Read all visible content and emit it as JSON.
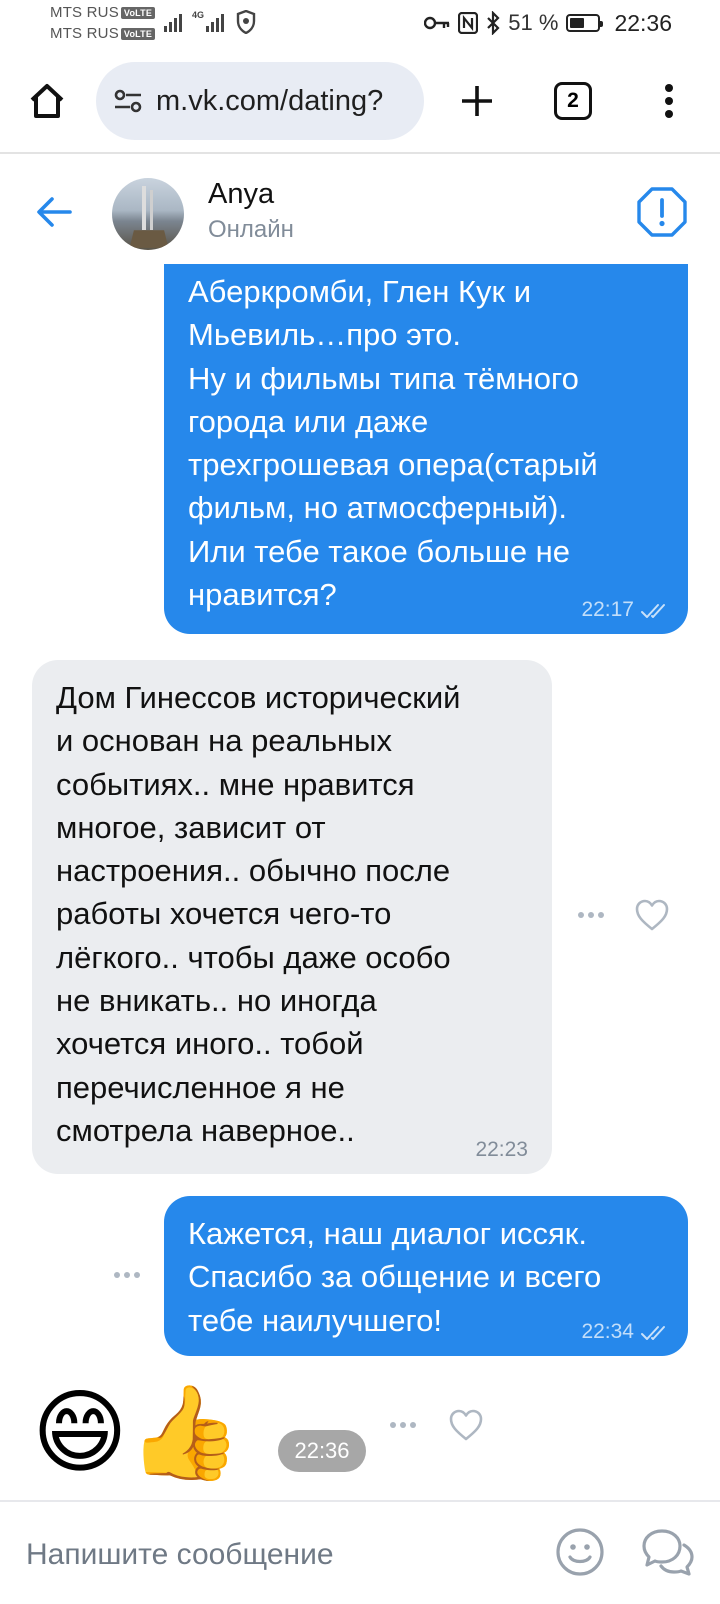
{
  "status_bar": {
    "carrier_1": "MTS RUS",
    "carrier_2": "MTS RUS",
    "volte": "VoLTE",
    "net_type": "4G",
    "battery_percent": "51 %",
    "battery_level": 0.51,
    "time": "22:36"
  },
  "browser": {
    "url": "m.vk.com/dating?",
    "tab_count": "2"
  },
  "chat": {
    "contact_name": "Anya",
    "contact_status": "Онлайн",
    "messages": [
      {
        "direction": "outgoing",
        "text": "Аберкромби, Глен Кук и\nМьевиль…про это.\nНу и фильмы типа тёмного\nгорода или даже\nтрехгрошевая опера(старый\nфильм, но атмосферный).\nИли тебе такое больше не\nнравится?",
        "time": "22:17",
        "read": true
      },
      {
        "direction": "incoming",
        "text": "Дом Гинессов исторический\nи основан на реальных\nсобытиях.. мне нравится\nмногое, зависит от\nнастроения.. обычно после\nработы хочется чего-то\nлёгкого.. чтобы даже особо\nне вникать.. но иногда\nхочется иного.. тобой\nперечисленное я не\nсмотрела наверное..",
        "time": "22:23"
      },
      {
        "direction": "outgoing",
        "text": "Кажется, наш диалог иссяк.\nСпасибо за общение и всего\nтебе наилучшего!",
        "time": "22:34",
        "read": true
      },
      {
        "direction": "incoming",
        "emoji": "😄👍",
        "time": "22:36"
      }
    ]
  },
  "composer": {
    "placeholder": "Напишите сообщение"
  },
  "icons": {
    "back": "arrow-left-icon",
    "report": "exclamation-octagon-icon",
    "emoji": "smile-icon",
    "chat": "chat-bubbles-icon",
    "like": "heart-icon",
    "more": "ellipsis-icon"
  },
  "colors": {
    "accent": "#2688eb",
    "outgoing_bubble": "#2688eb",
    "incoming_bubble": "#ebedf0",
    "secondary_text": "#818c99"
  }
}
